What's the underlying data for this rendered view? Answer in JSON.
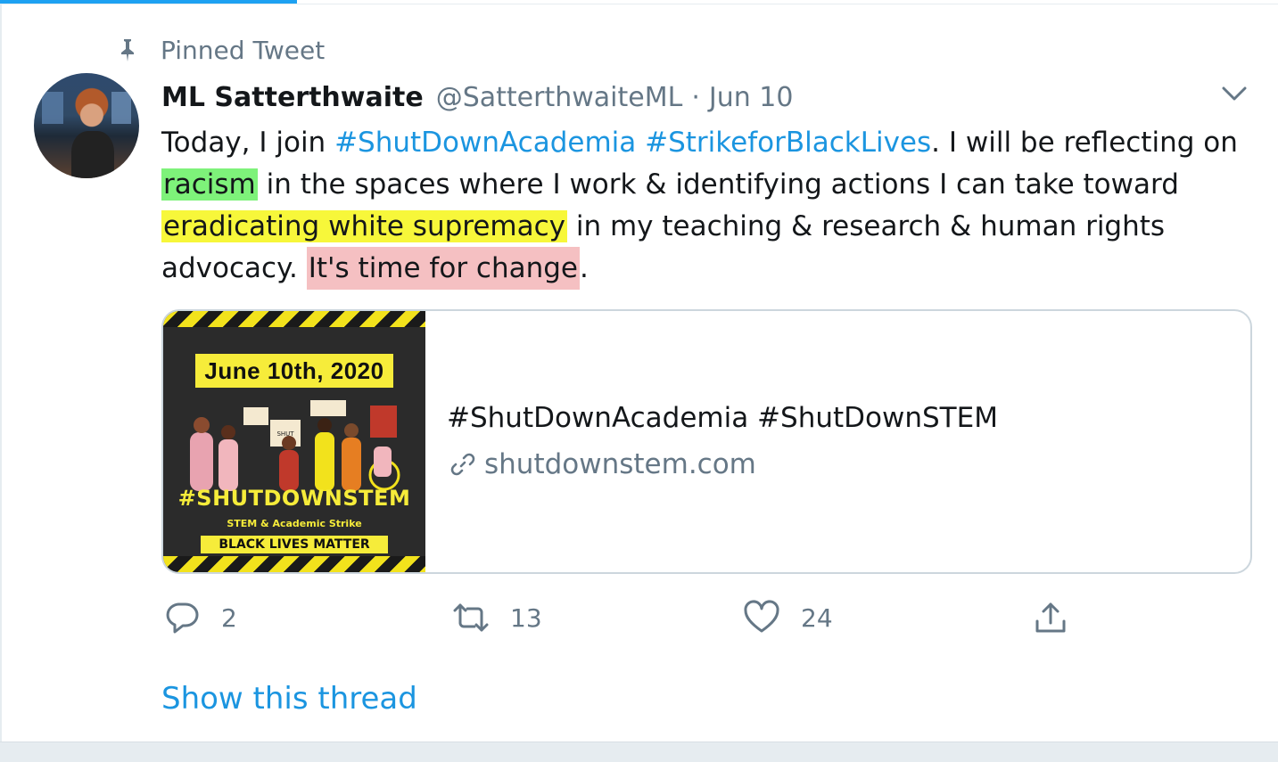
{
  "pinned": {
    "label": "Pinned Tweet"
  },
  "author": {
    "name": "ML Satterthwaite",
    "handle": "@SatterthwaiteML",
    "separator": "·",
    "date": "Jun 10"
  },
  "tweet": {
    "segments": {
      "s1": "Today, I join ",
      "h1": "#ShutDownAcademia",
      "s2": " ",
      "h2": "#StrikeforBlackLives",
      "s3": ". I will be reflecting on ",
      "hl1": "racism",
      "s4": " in the spaces where I work & identifying actions I can take toward ",
      "hl2": "eradicating white supremacy",
      "s5": " in my teaching & research & human rights advocacy",
      "s6": ". ",
      "hl3": "It's time for change",
      "s7": "."
    },
    "highlight_colors": {
      "green": "#7ef27a",
      "yellow": "#f7f73a",
      "pink": "#f5c0c2"
    }
  },
  "card": {
    "title": "#ShutDownAcademia #ShutDownSTEM",
    "link": "shutdownstem.com",
    "image": {
      "date_text": "June 10th, 2020",
      "hashtag_text": "#SHUTDOWNSTEM",
      "subtitle": "STEM & Academic Strike",
      "banner": "BLACK LIVES MATTER"
    }
  },
  "actions": {
    "reply_count": "2",
    "retweet_count": "13",
    "like_count": "24"
  },
  "show_thread": "Show this thread",
  "colors": {
    "link": "#1b95e0",
    "muted": "#657786",
    "text": "#14171a",
    "accent": "#1da1f2"
  },
  "icons": [
    "pin-icon",
    "chevron-down-icon",
    "link-icon",
    "reply-icon",
    "retweet-icon",
    "like-icon",
    "share-icon"
  ]
}
